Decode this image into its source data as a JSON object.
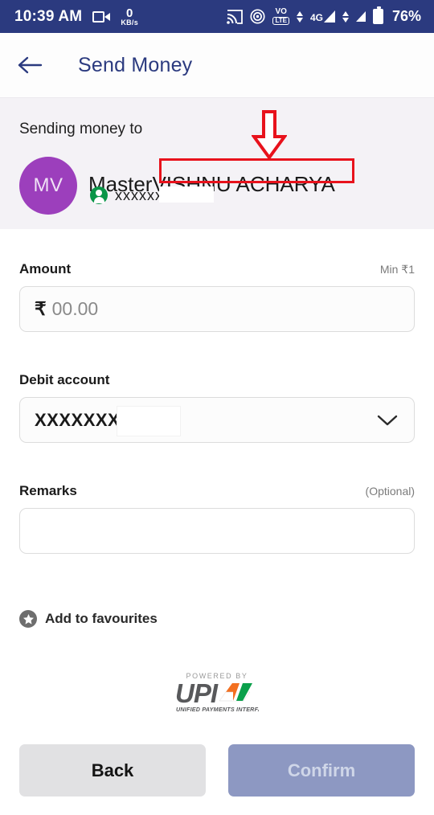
{
  "status_bar": {
    "time": "10:39 AM",
    "net_speed_value": "0",
    "net_speed_unit": "KB/s",
    "battery_percent": "76%",
    "network_type": "4G",
    "volte_top": "VO",
    "volte_bottom": "LTE",
    "icons": [
      "screen-record-icon",
      "network-speed-icon",
      "cast-icon",
      "hotspot-icon",
      "volte-icon",
      "data-arrows-icon",
      "signal-4g-icon",
      "signal-sim2-icon",
      "battery-icon"
    ],
    "background_color": "#2b3a7f"
  },
  "header": {
    "title": "Send Money",
    "back_icon": "arrow-left-icon",
    "title_color": "#2b3a7f"
  },
  "recipient": {
    "section_label": "Sending money to",
    "avatar_initials": "MV",
    "avatar_color": "#9c3fbc",
    "name_prefix": "Master",
    "name_highlighted": "VISHNU  ACHARYA",
    "upi_id_masked": "xxxxxxx",
    "upi_icon": "person-circle-icon",
    "background_color": "#f4f2f6"
  },
  "annotation": {
    "box_color": "#e8121c",
    "arrow_icon": "arrow-down-outline-icon",
    "target": "VISHNU  ACHARYA"
  },
  "form": {
    "amount": {
      "label": "Amount",
      "hint": "Min ₹1",
      "currency_symbol": "₹",
      "placeholder": "00.00",
      "value": "00.00"
    },
    "debit_account": {
      "label": "Debit account",
      "value": "XXXXXXX",
      "dropdown_icon": "chevron-down-icon"
    },
    "remarks": {
      "label": "Remarks",
      "hint": "(Optional)",
      "value": "",
      "placeholder": ""
    },
    "favourites": {
      "label": "Add to favourites",
      "icon": "star-circle-icon"
    }
  },
  "upi_branding": {
    "powered_by": "POWERED BY",
    "wordmark": "UPI",
    "tagline": "UNIFIED PAYMENTS INTERFACE"
  },
  "footer": {
    "back_label": "Back",
    "confirm_label": "Confirm",
    "back_color": "#e1e1e3",
    "confirm_color": "#8d98c2"
  }
}
